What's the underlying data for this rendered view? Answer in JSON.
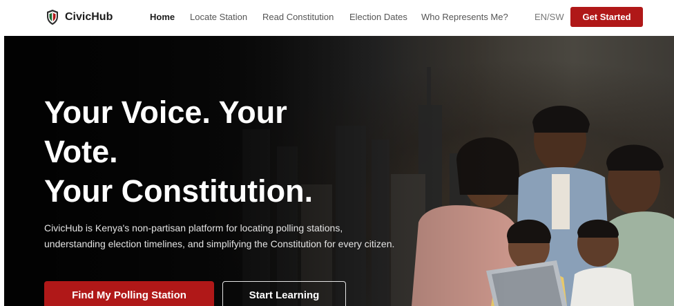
{
  "brand": {
    "name": "CivicHub",
    "icon": "shield-flag-icon",
    "accent": "#b01818"
  },
  "nav": {
    "links": [
      {
        "label": "Home",
        "active": true
      },
      {
        "label": "Locate Station",
        "active": false
      },
      {
        "label": "Read Constitution",
        "active": false
      },
      {
        "label": "Election Dates",
        "active": false
      },
      {
        "label": "Who Represents Me?",
        "active": false
      }
    ],
    "language_toggle": "EN/SW",
    "cta_label": "Get Started"
  },
  "hero": {
    "title_lines": [
      "Your Voice. Your",
      "Vote.",
      "Your Constitution."
    ],
    "description": "CivicHub is Kenya's non-partisan platform for locating polling stations, understanding election timelines, and simplifying the Constitution for every citizen.",
    "primary_button": "Find My Polling Station",
    "secondary_button": "Start Learning",
    "image": "family-with-tablet-city-skyline-photo"
  }
}
